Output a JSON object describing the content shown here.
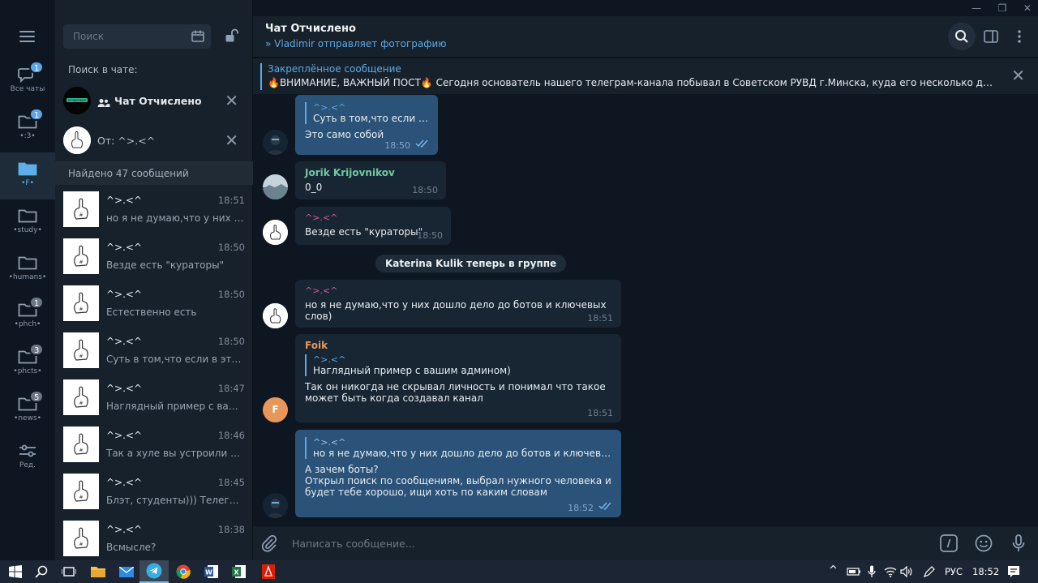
{
  "window": {
    "min": "—",
    "max": "❐",
    "close": "✕"
  },
  "folders": [
    {
      "label": "Все чаты",
      "badge": "1",
      "muted": false,
      "active": false
    },
    {
      "label": "•:3•",
      "badge": "1",
      "muted": false,
      "active": false
    },
    {
      "label": "•F•",
      "badge": "",
      "muted": false,
      "active": true
    },
    {
      "label": "•study•",
      "badge": "",
      "muted": false,
      "active": false
    },
    {
      "label": "•humans•",
      "badge": "",
      "muted": false,
      "active": false
    },
    {
      "label": "•phch•",
      "badge": "1",
      "muted": true,
      "active": false
    },
    {
      "label": "•phcts•",
      "badge": "3",
      "muted": true,
      "active": false
    },
    {
      "label": "•news•",
      "badge": "5",
      "muted": true,
      "active": false
    },
    {
      "label": "Ред.",
      "badge": "",
      "muted": false,
      "active": false
    }
  ],
  "search": {
    "placeholder": "Поиск",
    "hint": "Поиск в чате:",
    "chat_filter": "Чат Отчислено",
    "from_filter": "От: ^>.<^",
    "found": "Найдено 47 сообщений"
  },
  "results": [
    {
      "name": "^>.<^",
      "time": "18:51",
      "text": "но я не думаю,что у них до..."
    },
    {
      "name": "^>.<^",
      "time": "18:50",
      "text": "Везде есть \"кураторы\""
    },
    {
      "name": "^>.<^",
      "time": "18:50",
      "text": "Естественно есть"
    },
    {
      "name": "^>.<^",
      "time": "18:50",
      "text": "Суть в том,что если в этом ..."
    },
    {
      "name": "^>.<^",
      "time": "18:47",
      "text": "Наглядный пример с ваши..."
    },
    {
      "name": "^>.<^",
      "time": "18:46",
      "text": "Так а хуле вы устроили тут ..."
    },
    {
      "name": "^>.<^",
      "time": "18:45",
      "text": "Блэт, студенты))) Телега же ..."
    },
    {
      "name": "^>.<^",
      "time": "18:38",
      "text": "Всмысле?"
    }
  ],
  "header": {
    "title": "Чат Отчислено",
    "status": "Vladimir отправляет фотографию"
  },
  "pinned": {
    "title": "Закреплённое сообщение",
    "text": "🔥ВНИМАНИЕ, ВАЖНЫЙ ПОСТ🔥  Сегодня основатель нашего телеграм-канала побывал в Советском РУВД г.Минска, куда его несколько дней назад ..."
  },
  "messages": {
    "m1": {
      "reply_name": "^>.<^",
      "reply_text": "Суть в том,что если в э...",
      "text": "Это само собой",
      "time": "18:50"
    },
    "m2": {
      "author": "Jorik Krijovnikov",
      "text": "0_0",
      "time": "18:50"
    },
    "m3": {
      "author": "^>.<^",
      "text": "Везде есть \"кураторы\"",
      "time": "18:50"
    },
    "service": "Katerina Kulik теперь в группе",
    "m4": {
      "author": "^>.<^",
      "text": "но я не думаю,что у них дошло дело до ботов и ключевых слов)",
      "time": "18:51"
    },
    "m5": {
      "author": "Foik",
      "reply_name": "^>.<^",
      "reply_text": "Наглядный пример с вашим админом)",
      "line1": "Так он никогда не скрывал личность и понимал что такое",
      "line2": "может быть когда создавал канал",
      "time": "18:51",
      "avatar_letter": "F"
    },
    "m6": {
      "reply_name": "^>.<^",
      "reply_text": "но я не думаю,что у них дошло дело до ботов и ключевых сл...",
      "line1": "А зачем боты?",
      "line2": "Открыл поиск по сообщениям, выбрал нужного человека и",
      "line3": "будет тебе хорошо, ищи хоть по каким словам",
      "time": "18:52"
    }
  },
  "composer": {
    "placeholder": "Написать сообщение..."
  },
  "taskbar": {
    "lang": "РУС",
    "clock": "18:52"
  },
  "colors": {
    "accent": "#5ea9e6",
    "pink": "#e0569a",
    "green": "#6fc9a2",
    "orange": "#e7975a"
  }
}
